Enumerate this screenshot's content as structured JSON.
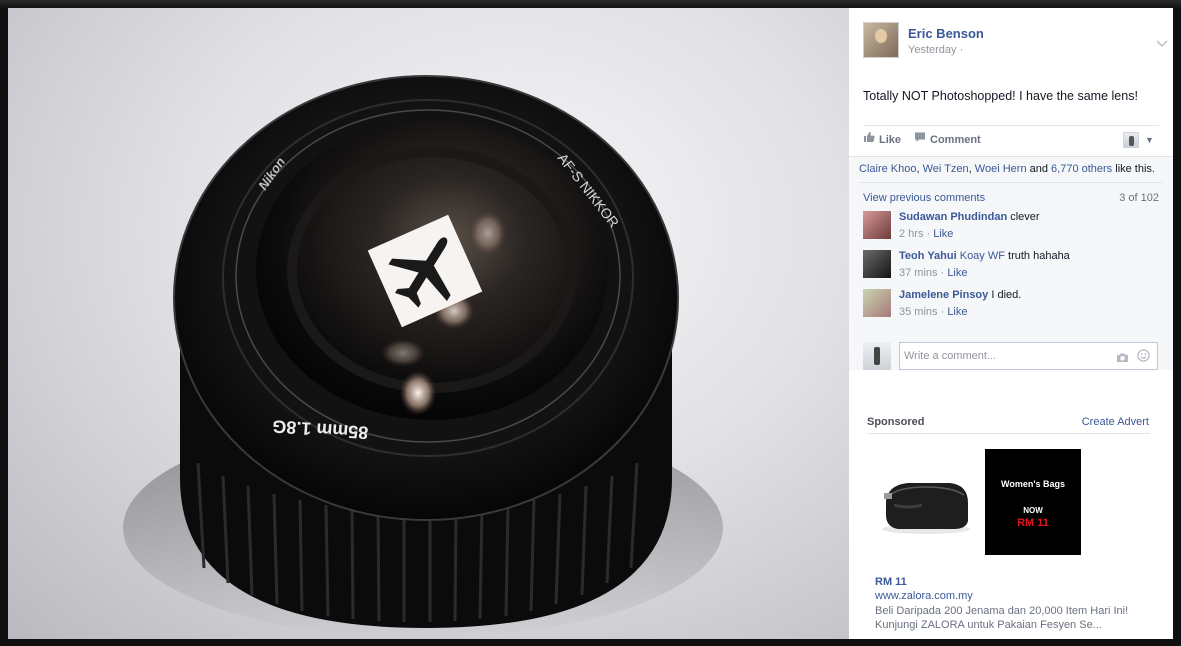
{
  "post": {
    "author": "Eric Benson",
    "time": "Yesterday ·",
    "text": "Totally NOT Photoshopped! I have the same lens!",
    "menu_icon": "chevron-down-icon"
  },
  "photo": {
    "lens_brand": "Nikon",
    "lens_model": "AF-S NIKKOR",
    "lens_spec": "85mm 1.8G",
    "sticker_icon": "airplane-icon"
  },
  "actions": {
    "like_label": "Like",
    "comment_label": "Comment"
  },
  "likes": {
    "names": [
      "Claire Khoo",
      "Wei Tzen",
      "Woei Hern"
    ],
    "sep": ", ",
    "and": " and ",
    "others_link": "6,770 others",
    "suffix": " like this."
  },
  "comments": {
    "view_previous": "View previous comments",
    "count": "3 of 102",
    "items": [
      {
        "name": "Sudawan Phudindan",
        "tag": "",
        "text": " clever",
        "time": "2 hrs",
        "like": "Like"
      },
      {
        "name": "Teoh Yahui",
        "tag": " Koay WF",
        "text": " truth hahaha",
        "time": "37 mins",
        "like": "Like"
      },
      {
        "name": "Jamelene Pinsoy",
        "tag": "",
        "text": " I died.",
        "time": "35 mins",
        "like": "Like"
      }
    ],
    "meta_sep": " · ",
    "input_placeholder": "Write a comment..."
  },
  "sponsored": {
    "label": "Sponsored",
    "create_advert": "Create Advert",
    "image_title": "Women's Bags",
    "image_now": "NOW",
    "image_price": "RM 11",
    "headline": "RM 11",
    "domain": "www.zalora.com.my",
    "description": "Beli Daripada 200 Jenama dan 20,000 Item Hari Ini! Kunjungi ZALORA untuk Pakaian Fesyen Se..."
  },
  "colors": {
    "link": "#3b5998",
    "muted": "#90949c",
    "feedback_bg": "#f6f7f9",
    "ad_price": "#e0141e"
  }
}
